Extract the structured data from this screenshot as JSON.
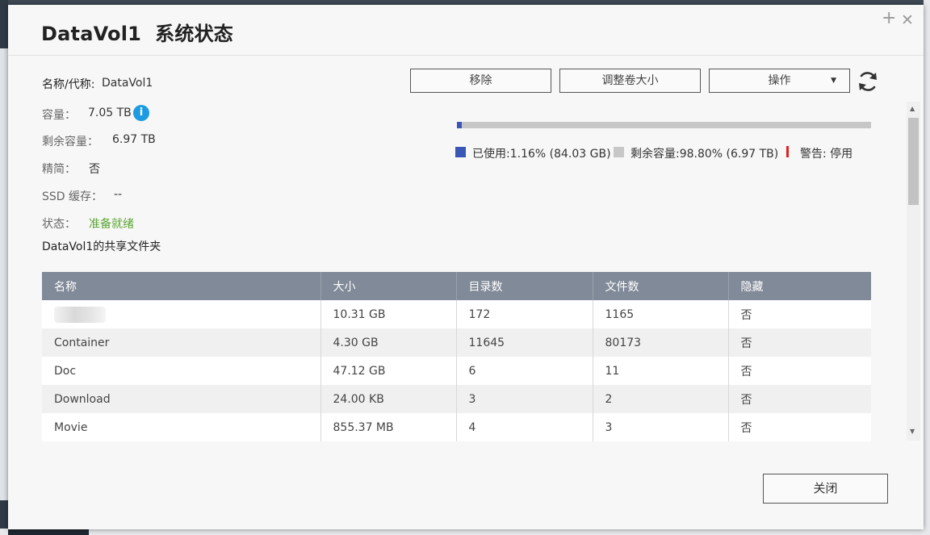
{
  "dialog": {
    "title": "DataVol1  系统状态",
    "window_buttons": {
      "add": "+",
      "close": "✕"
    }
  },
  "info": {
    "name_label": "名称/代称:",
    "name_value": "DataVol1",
    "capacity_label": "容量：",
    "capacity_value": "7.05 TB",
    "free_label": "剩余容量：",
    "free_value": "6.97 TB",
    "thin_label": "精简：",
    "thin_value": "否",
    "ssd_cache_label": "SSD 缓存：",
    "ssd_cache_value": "--",
    "status_label": "状态：",
    "status_value": "准备就绪"
  },
  "actions": {
    "remove": "移除",
    "resize": "调整卷大小",
    "operate": "操作",
    "operate_caret": "▼",
    "refresh_icon": "refresh-icon"
  },
  "usage": {
    "used_fraction": 0.0116,
    "used_text": "已使用:1.16% (84.03 GB)",
    "free_text": "剩余容量:98.80% (6.97 TB)",
    "warning_text": "警告: 停用",
    "used_color": "#3a57b5",
    "free_color": "#c7c7c7",
    "warning_color": "#e02020"
  },
  "shares": {
    "title": "DataVol1的共享文件夹",
    "columns": [
      "名称",
      "大小",
      "目录数",
      "文件数",
      "隐藏"
    ],
    "rows": [
      {
        "name": "",
        "size": "10.31 GB",
        "dirs": "172",
        "files": "1165",
        "hidden": "否"
      },
      {
        "name": "Container",
        "size": "4.30 GB",
        "dirs": "11645",
        "files": "80173",
        "hidden": "否"
      },
      {
        "name": "Doc",
        "size": "47.12 GB",
        "dirs": "6",
        "files": "11",
        "hidden": "否"
      },
      {
        "name": "Download",
        "size": "24.00 KB",
        "dirs": "3",
        "files": "2",
        "hidden": "否"
      },
      {
        "name": "Movie",
        "size": "855.37 MB",
        "dirs": "4",
        "files": "3",
        "hidden": "否"
      }
    ]
  },
  "footer": {
    "close": "关闭"
  },
  "scroll": {
    "up": "▲",
    "down": "▼"
  }
}
